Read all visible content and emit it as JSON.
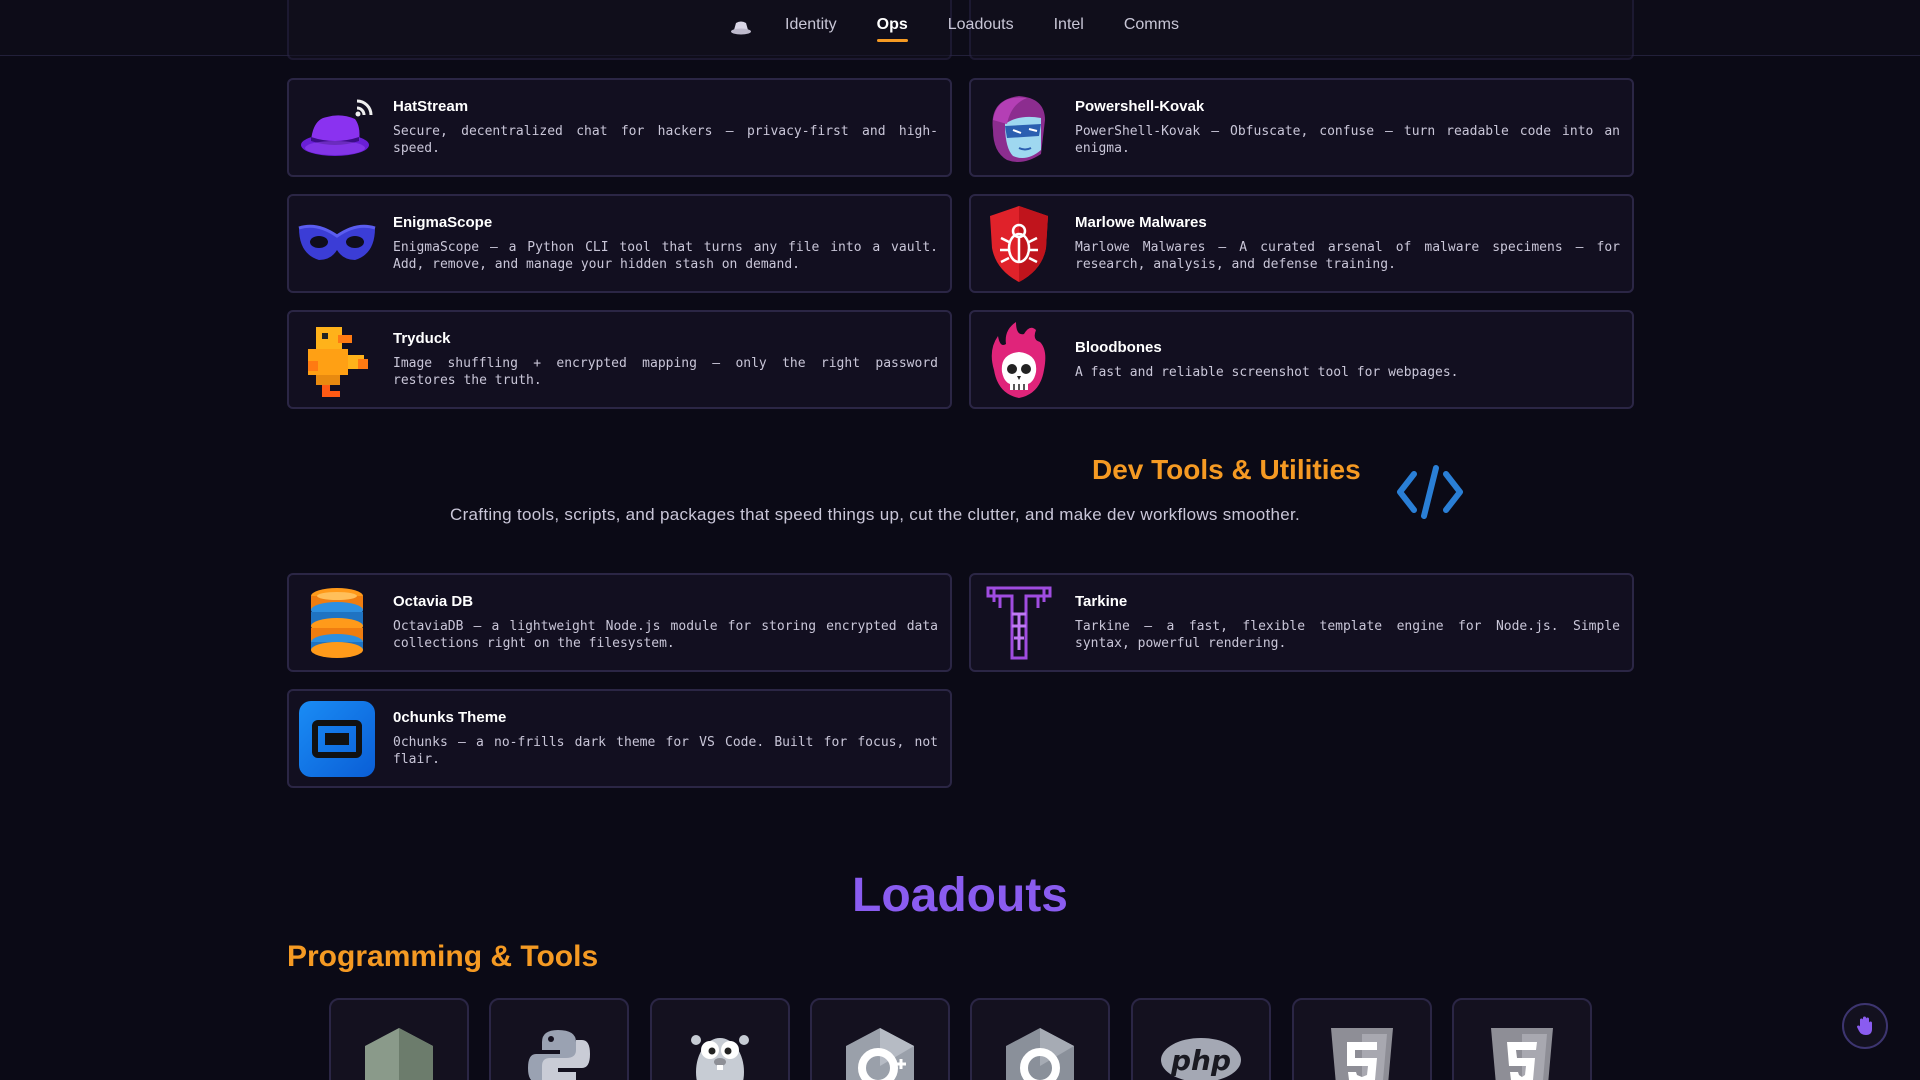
{
  "nav": {
    "logo_icon": "hat-icon",
    "items": [
      {
        "label": "Identity",
        "active": false
      },
      {
        "label": "Ops",
        "active": true
      },
      {
        "label": "Loadouts",
        "active": false
      },
      {
        "label": "Intel",
        "active": false
      },
      {
        "label": "Comms",
        "active": false
      }
    ]
  },
  "ops_cards": [
    {
      "title": "HatStream",
      "desc": "Secure, decentralized chat for hackers — privacy-first and high-speed.",
      "icon": "hat-stream-icon"
    },
    {
      "title": "Powershell-Kovak",
      "desc": "PowerShell-Kovak — Obfuscate, confuse — turn readable code into an enigma.",
      "icon": "masked-face-icon"
    },
    {
      "title": "EnigmaScope",
      "desc": "EnigmaScope — a Python CLI tool that turns any file into a vault. Add, remove, and manage your hidden stash on demand.",
      "icon": "eye-mask-icon"
    },
    {
      "title": "Marlowe Malwares",
      "desc": "Marlowe Malwares — A curated arsenal of malware specimens — for research, analysis, and defense training.",
      "icon": "bug-shield-icon"
    },
    {
      "title": "Tryduck",
      "desc": "Image shuffling + encrypted mapping — only the right password restores the truth.",
      "icon": "pixel-duck-icon"
    },
    {
      "title": "Bloodbones",
      "desc": "A fast and reliable screenshot tool for webpages.",
      "icon": "flaming-skull-icon"
    }
  ],
  "dev_section": {
    "title": "Dev Tools & Utilities",
    "subtitle": "Crafting tools, scripts, and packages that speed things up, cut the clutter, and make dev workflows smoother.",
    "icon": "code-brackets-icon"
  },
  "dev_cards": [
    {
      "title": "Octavia DB",
      "desc": "OctaviaDB — a lightweight Node.js module for storing encrypted data collections right on the filesystem.",
      "icon": "database-icon"
    },
    {
      "title": "Tarkine",
      "desc": "Tarkine — a fast, flexible template engine for Node.js. Simple syntax, powerful rendering.",
      "icon": "tarkine-logo-icon"
    },
    {
      "title": "0chunks Theme",
      "desc": "0chunks — a no-frills dark theme for VS Code. Built for focus, not flair.",
      "icon": "vscode-theme-icon"
    }
  ],
  "loadouts": {
    "title": "Loadouts",
    "subtitle": "Programming & Tools",
    "tools": [
      "nodejs-icon",
      "python-icon",
      "go-gopher-icon",
      "cpp-icon",
      "c-icon",
      "php-icon",
      "html5-icon",
      "css3-icon"
    ]
  },
  "colors": {
    "accent": "#f59a23",
    "purple": "#8a5cf0",
    "card_border": "#2b2645",
    "background": "#0b0a16"
  }
}
